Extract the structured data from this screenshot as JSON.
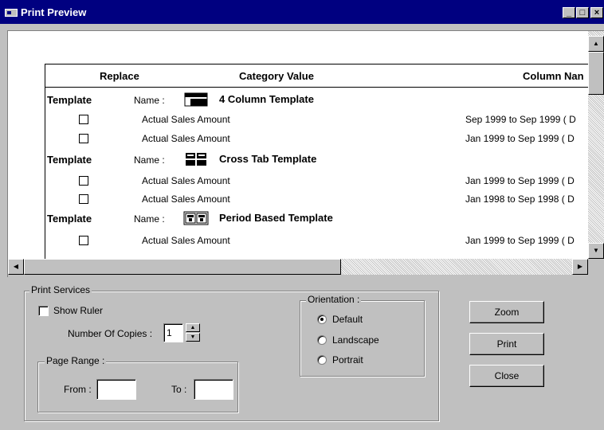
{
  "window": {
    "title": "Print Preview",
    "controls": {
      "minimize": "_",
      "maximize": "□",
      "close": "×"
    }
  },
  "table": {
    "headers": {
      "replace": "Replace",
      "category_value": "Category Value",
      "column_name": "Column Nan"
    },
    "name_label": "Name :",
    "template_label": "Template",
    "groups": [
      {
        "icon": "four-column-template-icon",
        "name": "4 Column Template",
        "rows": [
          {
            "measure": "Actual Sales Amount",
            "column_value": "Sep 1999 to Sep 1999 ( D"
          },
          {
            "measure": "Actual Sales Amount",
            "column_value": "Jan 1999 to Sep 1999 ( D"
          }
        ]
      },
      {
        "icon": "cross-tab-template-icon",
        "name": "Cross Tab Template",
        "rows": [
          {
            "measure": "Actual Sales Amount",
            "column_value": "Jan 1999 to Sep 1999 ( D"
          },
          {
            "measure": "Actual Sales Amount",
            "column_value": "Jan 1998 to Sep 1998 ( D"
          }
        ]
      },
      {
        "icon": "period-based-template-icon",
        "name": "Period Based Template",
        "rows": [
          {
            "measure": "Actual Sales Amount",
            "column_value": "Jan 1999 to Sep 1999 ( D"
          }
        ]
      }
    ]
  },
  "print_services": {
    "label": "Print Services",
    "show_ruler": {
      "label": "Show Ruler",
      "checked": false
    },
    "copies": {
      "label": "Number Of Copies :",
      "value": "1"
    },
    "page_range": {
      "label": "Page Range :",
      "from_label": "From :",
      "from_value": "",
      "to_label": "To :",
      "to_value": ""
    },
    "orientation": {
      "label": "Orientation :",
      "options": [
        "Default",
        "Landscape",
        "Portrait"
      ],
      "selected": "Default"
    }
  },
  "buttons": {
    "zoom": "Zoom",
    "print": "Print",
    "close": "Close"
  }
}
